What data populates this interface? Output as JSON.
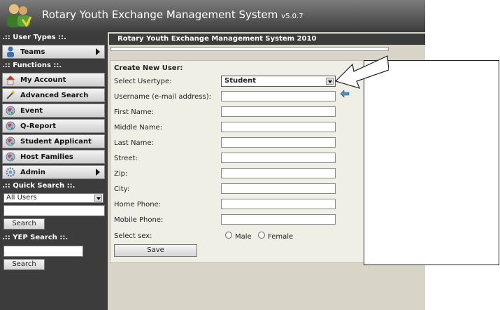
{
  "header": {
    "title": "Rotary Youth Exchange Management System",
    "version": "v5.0.7"
  },
  "sidebar": {
    "user_types_title": ".:: User Types ::.",
    "teams_label": "Teams",
    "functions_title": ".:: Functions ::.",
    "functions": [
      {
        "label": "My Account",
        "icon": "house-icon"
      },
      {
        "label": "Advanced Search",
        "icon": "magic-wand-icon"
      },
      {
        "label": "Event",
        "icon": "globe-icon"
      },
      {
        "label": "Q-Report",
        "icon": "globe-icon"
      },
      {
        "label": "Student Applicant",
        "icon": "globe-icon"
      },
      {
        "label": "Host Families",
        "icon": "globe-icon"
      },
      {
        "label": "Admin",
        "icon": "gear-icon"
      }
    ],
    "quick_search_title": ".:: Quick Search ::.",
    "quick_search_select": "All Users",
    "quick_search_button": "Search",
    "yep_search_title": ".:: YEP Search ::.",
    "yep_search_button": "Search"
  },
  "content": {
    "title": "Rotary Youth Exchange Management System 2010"
  },
  "form": {
    "heading": "Create New User:",
    "usertype_label": "Select Usertype:",
    "usertype_value": "Student",
    "fields": [
      "Username (e-mail address):",
      "First Name:",
      "Middle Name:",
      "Last Name:",
      "Street:",
      "Zip:",
      "City:",
      "Home Phone:",
      "Mobile Phone:"
    ],
    "sex_label": "Select sex:",
    "male_label": "Male",
    "female_label": "Female",
    "save_button": "Save"
  }
}
